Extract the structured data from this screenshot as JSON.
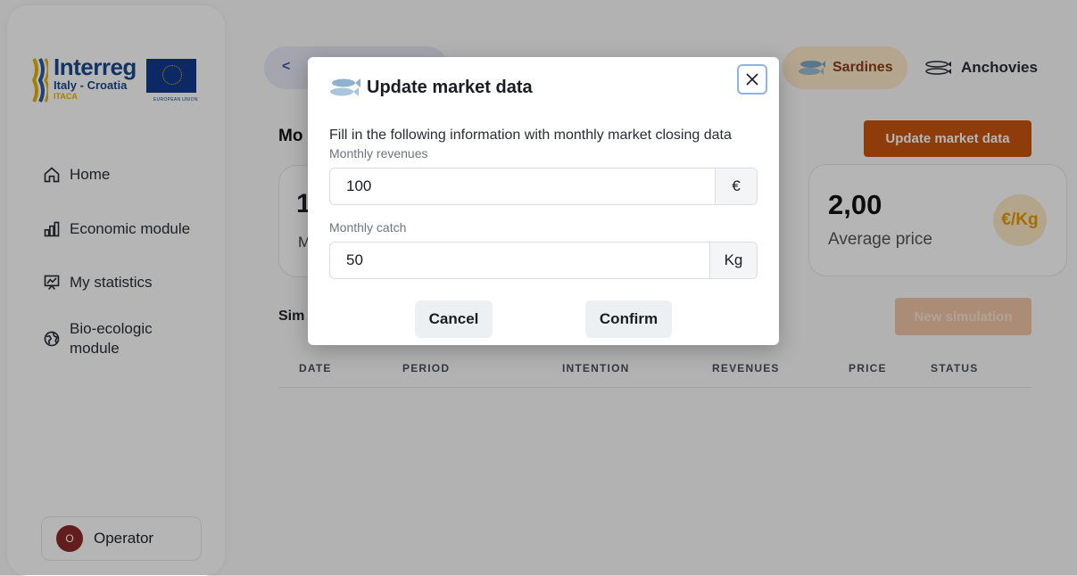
{
  "logo": {
    "title": "Interreg",
    "subtitle": "Italy - Croatia",
    "program": "ITACA",
    "eu": "EUROPEAN UNION"
  },
  "sidebar": {
    "items": [
      {
        "label": "Home",
        "icon": "home-icon"
      },
      {
        "label": "Economic module",
        "icon": "bar-chart-icon"
      },
      {
        "label": "My statistics",
        "icon": "statistics-icon"
      },
      {
        "label": "Bio-ecologic module",
        "icon": "globe-icon"
      }
    ],
    "user": {
      "initial": "O",
      "name": "Operator"
    }
  },
  "main": {
    "back_label": "<",
    "title_partial": "Mo",
    "species_selected": "Sardines",
    "species_other": "Anchovies",
    "update_button": "Update market data",
    "card_left": {
      "value_partial": "1",
      "label_partial": "M"
    },
    "price_card": {
      "value": "2,00",
      "label": "Average price",
      "unit": "€/Kg"
    },
    "simulations_title_partial": "Sim",
    "new_simulation_button": "New simulation",
    "table_headers": [
      "DATE",
      "PERIOD",
      "INTENTION",
      "REVENUES",
      "PRICE",
      "STATUS"
    ]
  },
  "modal": {
    "title": "Update market data",
    "description": "Fill in the following information with monthly market closing data",
    "revenues_label": "Monthly revenues",
    "revenues_value": "100",
    "revenues_unit": "€",
    "catch_label": "Monthly catch",
    "catch_value": "50",
    "catch_unit": "Kg",
    "cancel": "Cancel",
    "confirm": "Confirm"
  },
  "colors": {
    "accent": "#c8560f",
    "overlay": "rgba(0,0,0,0.29)",
    "species_pill": "#fde9c8"
  }
}
